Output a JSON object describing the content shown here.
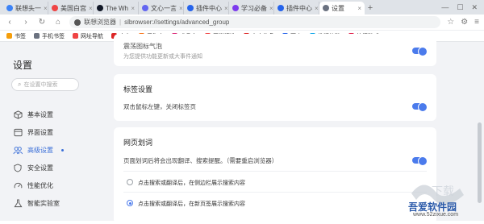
{
  "tabs": [
    {
      "label": "联想头一",
      "color": "#3b82f6"
    },
    {
      "label": "美国白宫",
      "color": "#ef4444"
    },
    {
      "label": "The Wh",
      "color": "#111827"
    },
    {
      "label": "文心一言",
      "color": "#6366f1"
    },
    {
      "label": "插件中心",
      "color": "#2563eb"
    },
    {
      "label": "学习必备",
      "color": "#7c3aed"
    },
    {
      "label": "插件中心",
      "color": "#2563eb"
    },
    {
      "label": "设置",
      "color": "#6b7280"
    }
  ],
  "toolbar": {
    "site_label": "联想浏览器",
    "url": "slbrowser://settings/advanced_group"
  },
  "bookmarks": [
    {
      "label": "书签",
      "color": "#f59e0b"
    },
    {
      "label": "手机书签",
      "color": "#6b7280"
    },
    {
      "label": "网址导航",
      "color": "#ef4444"
    },
    {
      "label": "京东",
      "color": "#dc2626"
    },
    {
      "label": "爱淘宝",
      "color": "#f97316"
    },
    {
      "label": "唯品会",
      "color": "#db2777"
    },
    {
      "label": "天猫精选",
      "color": "#ef4444"
    },
    {
      "label": "东方头条",
      "color": "#dc2626"
    },
    {
      "label": "百度",
      "color": "#2563eb"
    },
    {
      "label": "携程旅游",
      "color": "#0ea5e9"
    },
    {
      "label": "热门游戏",
      "color": "#e11d48"
    }
  ],
  "sidebar": {
    "title": "设置",
    "search_placeholder": "在设置中搜索",
    "items": [
      {
        "label": "基本设置",
        "icon": "cube-icon"
      },
      {
        "label": "界面设置",
        "icon": "layout-icon"
      },
      {
        "label": "高级设置",
        "icon": "users-icon"
      },
      {
        "label": "安全设置",
        "icon": "shield-icon"
      },
      {
        "label": "性能优化",
        "icon": "gauge-icon"
      },
      {
        "label": "智能实验室",
        "icon": "flask-icon"
      }
    ]
  },
  "main": {
    "partial_top": {
      "title": "震荡图标气泡",
      "desc": "为您提供功能更新或大事件通知"
    },
    "tab_settings": {
      "title": "标签设置",
      "row_label": "双击鼠标左键，关闭标签页"
    },
    "web_word": {
      "title": "网页划词",
      "row_label": "页面划词后将会出现翻译、搜索提醒。（需要重启浏览器）",
      "options": [
        "点击搜索或翻译后，在侧边栏展示搜索内容",
        "点击搜索或翻译后，在新页签展示搜索内容"
      ],
      "selected_index": 1
    }
  },
  "watermark": {
    "name": "吾爱软件园",
    "url": "www.52zixue.com"
  },
  "colors": {
    "accent": "#4b7bec",
    "page_bg": "#f2f3f6"
  }
}
